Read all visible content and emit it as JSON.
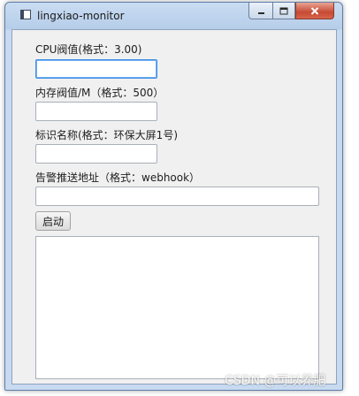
{
  "window": {
    "title": "lingxiao-monitor",
    "controls": {
      "minimize_icon": "minimize-icon",
      "maximize_icon": "maximize-icon",
      "close_icon": "close-icon"
    }
  },
  "form": {
    "cpu_label": "CPU阀值(格式：3.00)",
    "cpu_value": "",
    "memory_label": "内存阀值/M（格式：500）",
    "memory_value": "",
    "name_label": "标识名称(格式：环保大屏1号)",
    "name_value": "",
    "webhook_label": "告警推送地址（格式：webhook）",
    "webhook_value": "",
    "start_button": "启动",
    "log_output": ""
  },
  "watermark": "CSDN @可以养肥",
  "colors": {
    "focus_border": "#3e8ee5",
    "close_button": "#c74a34",
    "window_frame": "#c8daf0"
  }
}
